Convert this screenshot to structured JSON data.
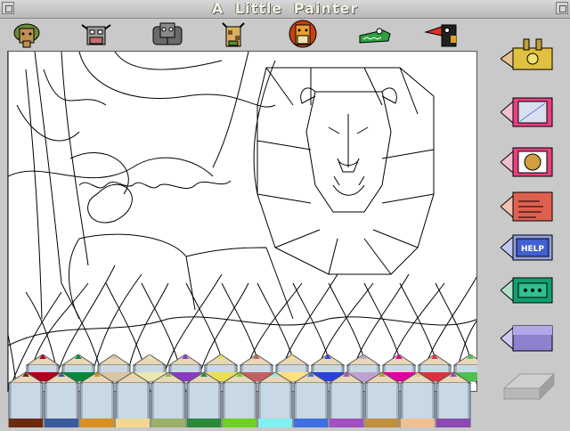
{
  "window": {
    "title": "A Little Painter"
  },
  "animals": [
    {
      "id": "elephant-head-icon"
    },
    {
      "id": "cow-head-icon"
    },
    {
      "id": "hippo-head-icon"
    },
    {
      "id": "giraffe-head-icon"
    },
    {
      "id": "lion-head-icon"
    },
    {
      "id": "crocodile-head-icon"
    },
    {
      "id": "toucan-head-icon"
    }
  ],
  "tools": {
    "help_label": "HELP"
  },
  "palette": {
    "back_row": [
      "#b00020",
      "#008a3a",
      "#d9c4a4",
      "#e8e8b0",
      "#8a3ac0",
      "#e8e050",
      "#c06060",
      "#ffe080",
      "#2a40e0",
      "#c0a0d0",
      "#e000a0",
      "#e03040",
      "#50c050"
    ],
    "front_row": [
      "#6a2a10",
      "#3a5a9a",
      "#d89020",
      "#f0d890",
      "#98b068",
      "#2a8a3a",
      "#70d020",
      "#80f0f0",
      "#4070e0",
      "#a050c0",
      "#c09040",
      "#f0c090",
      "#8a4ab0"
    ]
  }
}
